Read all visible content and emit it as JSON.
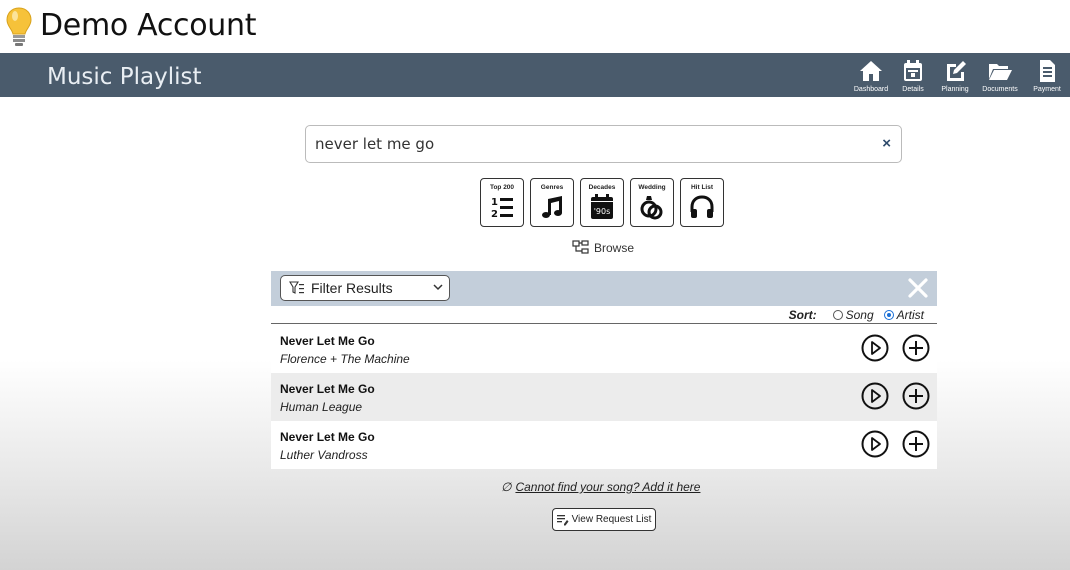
{
  "account": {
    "title": "Demo Account"
  },
  "header": {
    "page_title": "Music Playlist",
    "nav": [
      {
        "label": "Dashboard",
        "icon": "home-icon"
      },
      {
        "label": "Details",
        "icon": "calendar-icon"
      },
      {
        "label": "Planning",
        "icon": "edit-icon"
      },
      {
        "label": "Documents",
        "icon": "folder-icon"
      },
      {
        "label": "Payment",
        "icon": "invoice-icon"
      }
    ]
  },
  "search": {
    "value": "never let me go",
    "clear_label": "×"
  },
  "categories": [
    {
      "label": "Top 200",
      "icon": "numbered-list-icon"
    },
    {
      "label": "Genres",
      "icon": "music-note-icon"
    },
    {
      "label": "Decades",
      "icon": "calendar-90s-icon",
      "badge": "'90s"
    },
    {
      "label": "Wedding",
      "icon": "rings-icon"
    },
    {
      "label": "Hit List",
      "icon": "headphones-icon"
    }
  ],
  "browse": {
    "label": "Browse"
  },
  "filter": {
    "label": "Filter Results"
  },
  "sort": {
    "label": "Sort:",
    "options": [
      "Song",
      "Artist"
    ],
    "selected": "Artist"
  },
  "results": [
    {
      "song": "Never Let Me Go",
      "artist": "Florence + The Machine"
    },
    {
      "song": "Never Let Me Go",
      "artist": "Human League"
    },
    {
      "song": "Never Let Me Go",
      "artist": "Luther Vandross"
    }
  ],
  "footer": {
    "cant_find": "Cannot find your song? Add it here",
    "view_request": "View Request List"
  },
  "colors": {
    "header_bg": "#4a5b6c",
    "filter_bg": "#c3ceda",
    "accent": "#1a6fd6",
    "search_clear": "#2d4a6b"
  }
}
